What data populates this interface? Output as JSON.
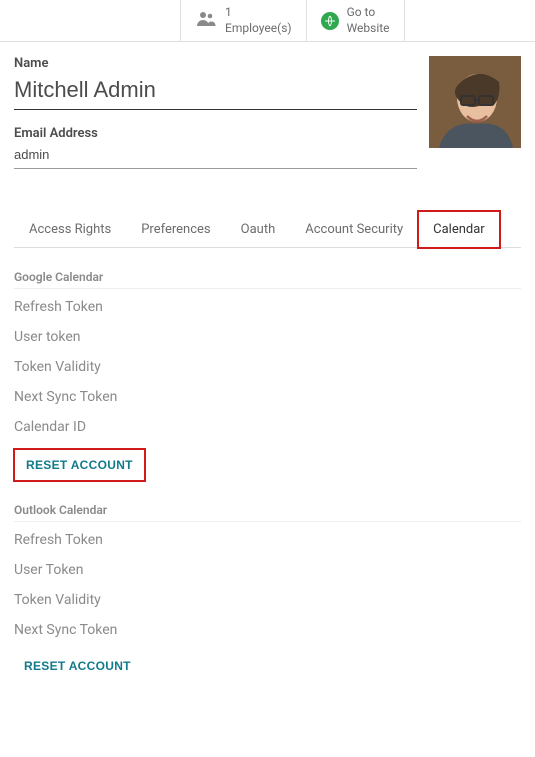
{
  "topbar": {
    "employees": {
      "count": "1",
      "label": "Employee(s)"
    },
    "website": {
      "line1": "Go to",
      "line2": "Website"
    }
  },
  "user": {
    "name_label": "Name",
    "name_value": "Mitchell Admin",
    "email_label": "Email Address",
    "email_value": "admin"
  },
  "tabs": [
    {
      "id": "access-rights",
      "label": "Access Rights",
      "active": false
    },
    {
      "id": "preferences",
      "label": "Preferences",
      "active": false
    },
    {
      "id": "oauth",
      "label": "Oauth",
      "active": false
    },
    {
      "id": "account-security",
      "label": "Account Security",
      "active": false
    },
    {
      "id": "calendar",
      "label": "Calendar",
      "active": true,
      "highlighted": true
    }
  ],
  "sections": [
    {
      "title": "Google Calendar",
      "fields": [
        "Refresh Token",
        "User token",
        "Token Validity",
        "Next Sync Token",
        "Calendar ID"
      ],
      "reset_label": "RESET ACCOUNT",
      "reset_highlighted": true
    },
    {
      "title": "Outlook Calendar",
      "fields": [
        "Refresh Token",
        "User Token",
        "Token Validity",
        "Next Sync Token"
      ],
      "reset_label": "RESET ACCOUNT",
      "reset_highlighted": false
    }
  ]
}
